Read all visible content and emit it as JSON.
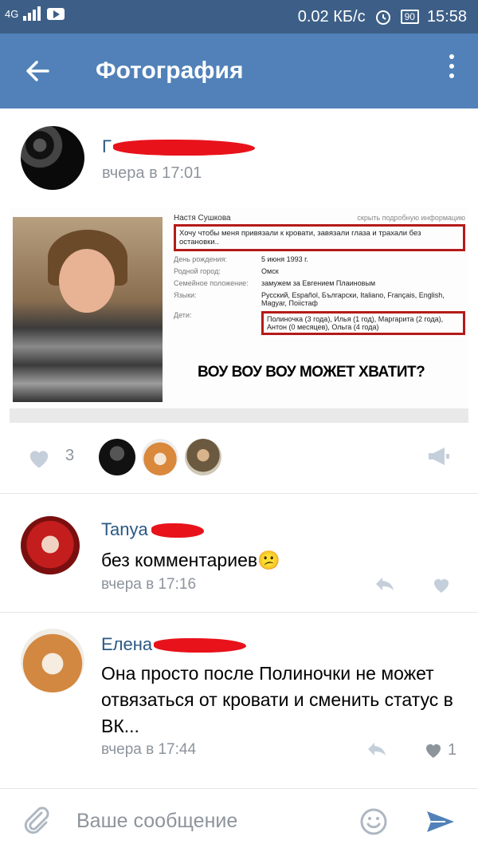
{
  "status_bar": {
    "network": "4G",
    "speed": "0.02 КБ/с",
    "battery": "90",
    "time": "15:58"
  },
  "app_bar": {
    "title": "Фотография",
    "back_icon": "arrow-left-icon",
    "more_icon": "more-vertical-icon"
  },
  "post": {
    "author_initial": "Г",
    "time": "вчера в 17:01",
    "photo": {
      "profile_name": "Настя Сушкова",
      "hide_link": "скрыть подробную информацию",
      "status": "Хочу чтобы меня привязали к кровати, завязали глаза и трахали без остановки..",
      "fields": [
        {
          "key": "День рождения:",
          "value": "5 июня 1993 г."
        },
        {
          "key": "Родной город:",
          "value": "Омск"
        },
        {
          "key": "Семейное положение:",
          "value": "замужем за Евгением Плаиновым"
        },
        {
          "key": "Языки:",
          "value": "Русский, Español, Български, Italiano, Français, English, Magyar, Поіістаф"
        }
      ],
      "children_key": "Дети:",
      "children_value": "Полиночка (3 года), Илья (1 год), Маргарита (2 года), Антон (0 месяцев), Ольга (4 года)",
      "caption": "ВОУ ВОУ ВОУ МОЖЕТ ХВАТИТ?"
    },
    "likes": "3"
  },
  "comments": [
    {
      "name": "Tanya",
      "text": "без комментариев😕",
      "time": "вчера в 17:16",
      "likes": ""
    },
    {
      "name": "Елена",
      "text": "Она просто после Полиночки не может отвязаться от кровати и сменить статус в ВК...",
      "time": "вчера в 17:44",
      "likes": "1"
    }
  ],
  "composer": {
    "placeholder": "Ваше сообщение"
  },
  "colors": {
    "status_bar": "#3d5f87",
    "app_bar": "#5181b8",
    "link": "#2a5885",
    "secondary": "#8d949c",
    "icon": "#c5cfdb",
    "redaction": "#e8121b"
  }
}
